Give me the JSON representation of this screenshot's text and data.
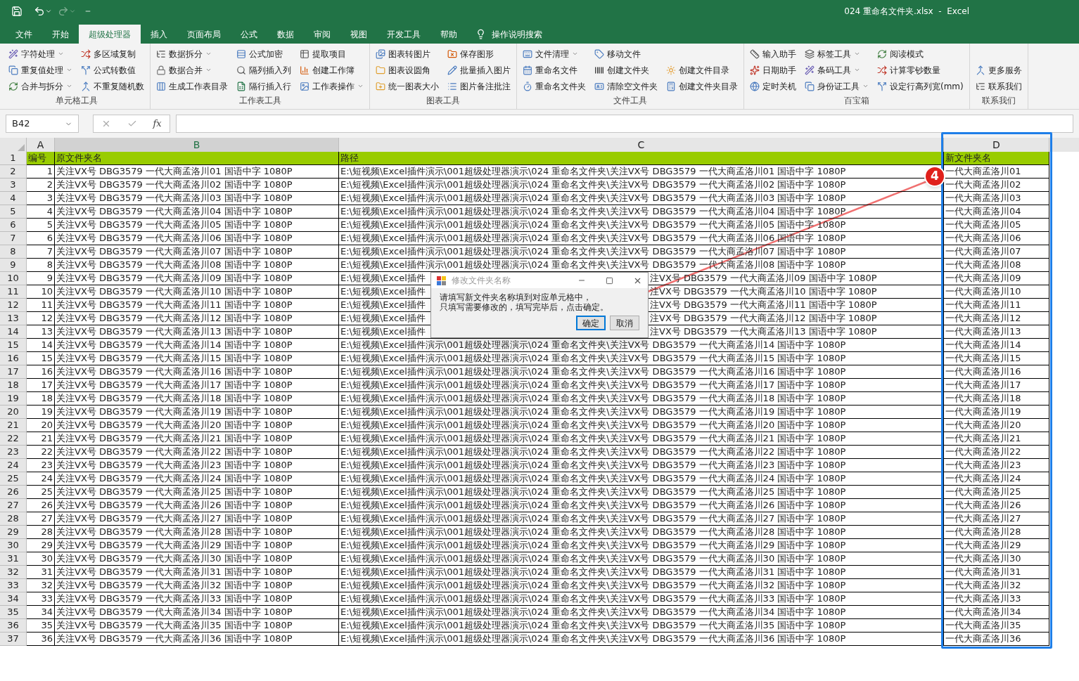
{
  "window": {
    "title": "024 重命名文件夹.xlsx  -  Excel"
  },
  "menu_tabs": [
    {
      "label": "文件",
      "selected": false
    },
    {
      "label": "开始",
      "selected": false
    },
    {
      "label": "超级处理器",
      "selected": true
    },
    {
      "label": "插入",
      "selected": false
    },
    {
      "label": "页面布局",
      "selected": false
    },
    {
      "label": "公式",
      "selected": false
    },
    {
      "label": "数据",
      "selected": false
    },
    {
      "label": "审阅",
      "selected": false
    },
    {
      "label": "视图",
      "selected": false
    },
    {
      "label": "开发工具",
      "selected": false
    },
    {
      "label": "帮助",
      "selected": false
    }
  ],
  "search_tab": "操作说明搜索",
  "ribbon_groups": [
    {
      "title": "单元格工具",
      "columns": [
        [
          {
            "label": "字符处理",
            "dropdown": true
          },
          {
            "label": "重复值处理",
            "dropdown": true
          },
          {
            "label": "合并与拆分",
            "dropdown": true
          }
        ],
        [
          {
            "label": "多区域复制",
            "dropdown": false
          },
          {
            "label": "公式转数值",
            "dropdown": false
          },
          {
            "label": "不重复随机数",
            "dropdown": false
          }
        ]
      ]
    },
    {
      "title": "工作表工具",
      "columns": [
        [
          {
            "label": "数据拆分",
            "dropdown": true
          },
          {
            "label": "数据合并",
            "dropdown": true
          },
          {
            "label": "生成工作表目录",
            "dropdown": false
          }
        ],
        [
          {
            "label": "公式加密",
            "dropdown": false
          },
          {
            "label": "隔列插入列",
            "dropdown": false
          },
          {
            "label": "隔行插入行",
            "dropdown": false
          }
        ],
        [
          {
            "label": "提取项目",
            "dropdown": false
          },
          {
            "label": "创建工作簿",
            "dropdown": false
          },
          {
            "label": "工作表操作",
            "dropdown": true
          }
        ]
      ]
    },
    {
      "title": "图表工具",
      "columns": [
        [
          {
            "label": "图表转图片",
            "dropdown": false
          },
          {
            "label": "图表设圆角",
            "dropdown": false
          },
          {
            "label": "统一图表大小",
            "dropdown": false
          }
        ],
        [
          {
            "label": "保存图形",
            "dropdown": false
          },
          {
            "label": "批量插入图片",
            "dropdown": false
          },
          {
            "label": "图片备注批注",
            "dropdown": false
          }
        ]
      ]
    },
    {
      "title": "文件工具",
      "columns": [
        [
          {
            "label": "文件清理",
            "dropdown": true
          },
          {
            "label": "重命名文件",
            "dropdown": false
          },
          {
            "label": "重命名文件夹",
            "dropdown": false
          }
        ],
        [
          {
            "label": "移动文件",
            "dropdown": false
          },
          {
            "label": "创建文件夹",
            "dropdown": false
          },
          {
            "label": "清除空文件夹",
            "dropdown": false
          }
        ],
        [
          {
            "label": "创建文件目录",
            "dropdown": false
          },
          {
            "label": "创建文件夹目录",
            "dropdown": false
          }
        ]
      ]
    },
    {
      "title": "百宝箱",
      "columns": [
        [
          {
            "label": "输入助手",
            "dropdown": false
          },
          {
            "label": "日期助手",
            "dropdown": false
          },
          {
            "label": "定时关机",
            "dropdown": false
          }
        ],
        [
          {
            "label": "标签工具",
            "dropdown": true
          },
          {
            "label": "条码工具",
            "dropdown": true
          },
          {
            "label": "身份证工具",
            "dropdown": true
          }
        ],
        [
          {
            "label": "阅读模式",
            "dropdown": false
          },
          {
            "label": "计算零钞数量",
            "dropdown": false
          },
          {
            "label": "设定行高列宽(mm)",
            "dropdown": false
          }
        ]
      ]
    },
    {
      "title": "联系我们",
      "columns": [
        [
          {
            "label": "更多服务",
            "dropdown": false
          },
          {
            "label": "联系我们",
            "dropdown": false
          }
        ]
      ]
    }
  ],
  "name_box": "B42",
  "formula_fx": "fx",
  "column_headers": [
    {
      "label": "A",
      "selected": false
    },
    {
      "label": "B",
      "selected": true
    },
    {
      "label": "C",
      "selected": false
    },
    {
      "label": "D",
      "selected": false
    }
  ],
  "header_row": {
    "number": "1",
    "cells": [
      "编号",
      "原文件夹名",
      "路径",
      "新文件夹名"
    ]
  },
  "rows": [
    {
      "kind": "data",
      "number": "2",
      "id": "1",
      "original": "关注VX号 DBG3579 一代大商孟洛川01 国语中字 1080P",
      "path": "E:\\短视频\\Excel插件演示\\001超级处理器演示\\024 重命名文件夹\\关注VX号 DBG3579 一代大商孟洛川01 国语中字 1080P",
      "new_name": "一代大商孟洛川01"
    },
    {
      "kind": "data",
      "number": "3",
      "id": "2",
      "original": "关注VX号 DBG3579 一代大商孟洛川02 国语中字 1080P",
      "path": "E:\\短视频\\Excel插件演示\\001超级处理器演示\\024 重命名文件夹\\关注VX号 DBG3579 一代大商孟洛川02 国语中字 1080P",
      "new_name": "一代大商孟洛川02"
    },
    {
      "kind": "data",
      "number": "4",
      "id": "3",
      "original": "关注VX号 DBG3579 一代大商孟洛川03 国语中字 1080P",
      "path": "E:\\短视频\\Excel插件演示\\001超级处理器演示\\024 重命名文件夹\\关注VX号 DBG3579 一代大商孟洛川03 国语中字 1080P",
      "new_name": "一代大商孟洛川03"
    },
    {
      "kind": "data",
      "number": "5",
      "id": "4",
      "original": "关注VX号 DBG3579 一代大商孟洛川04 国语中字 1080P",
      "path": "E:\\短视频\\Excel插件演示\\001超级处理器演示\\024 重命名文件夹\\关注VX号 DBG3579 一代大商孟洛川04 国语中字 1080P",
      "new_name": "一代大商孟洛川04"
    },
    {
      "kind": "data",
      "number": "6",
      "id": "5",
      "original": "关注VX号 DBG3579 一代大商孟洛川05 国语中字 1080P",
      "path": "E:\\短视频\\Excel插件演示\\001超级处理器演示\\024 重命名文件夹\\关注VX号 DBG3579 一代大商孟洛川05 国语中字 1080P",
      "new_name": "一代大商孟洛川05"
    },
    {
      "kind": "data",
      "number": "7",
      "id": "6",
      "original": "关注VX号 DBG3579 一代大商孟洛川06 国语中字 1080P",
      "path": "E:\\短视频\\Excel插件演示\\001超级处理器演示\\024 重命名文件夹\\关注VX号 DBG3579 一代大商孟洛川06 国语中字 1080P",
      "new_name": "一代大商孟洛川06"
    },
    {
      "kind": "data",
      "number": "8",
      "id": "7",
      "original": "关注VX号 DBG3579 一代大商孟洛川07 国语中字 1080P",
      "path": "E:\\短视频\\Excel插件演示\\001超级处理器演示\\024 重命名文件夹\\关注VX号 DBG3579 一代大商孟洛川07 国语中字 1080P",
      "new_name": "一代大商孟洛川07"
    },
    {
      "kind": "data",
      "number": "9",
      "id": "8",
      "original": "关注VX号 DBG3579 一代大商孟洛川08 国语中字 1080P",
      "path": "E:\\短视频\\Excel插件演示\\001超级处理器演示\\024 重命名文件夹\\关注VX号 DBG3579 一代大商孟洛川08 国语中字 1080P",
      "new_name": "一代大商孟洛川08"
    },
    {
      "kind": "covered",
      "number": "10",
      "id": "9",
      "original": "关注VX号 DBG3579 一代大商孟洛川09 国语中字 1080P",
      "path_start": "E:\\短视频\\Excel插件",
      "path_end": "注VX号 DBG3579 一代大商孟洛川09 国语中字 1080P",
      "new_name": "一代大商孟洛川09"
    },
    {
      "kind": "covered",
      "number": "11",
      "id": "10",
      "original": "关注VX号 DBG3579 一代大商孟洛川10 国语中字 1080P",
      "path_start": "E:\\短视频\\Excel插件",
      "path_end": "注VX号 DBG3579 一代大商孟洛川10 国语中字 1080P",
      "new_name": "一代大商孟洛川10"
    },
    {
      "kind": "covered",
      "number": "12",
      "id": "11",
      "original": "关注VX号 DBG3579 一代大商孟洛川11 国语中字 1080P",
      "path_start": "E:\\短视频\\Excel插件",
      "path_end": "注VX号 DBG3579 一代大商孟洛川11 国语中字 1080P",
      "new_name": "一代大商孟洛川11"
    },
    {
      "kind": "covered",
      "number": "13",
      "id": "12",
      "original": "关注VX号 DBG3579 一代大商孟洛川12 国语中字 1080P",
      "path_start": "E:\\短视频\\Excel插件",
      "path_end": "注VX号 DBG3579 一代大商孟洛川12 国语中字 1080P",
      "new_name": "一代大商孟洛川12"
    },
    {
      "kind": "covered",
      "number": "14",
      "id": "13",
      "original": "关注VX号 DBG3579 一代大商孟洛川13 国语中字 1080P",
      "path_start": "E:\\短视频\\Excel插件",
      "path_end": "注VX号 DBG3579 一代大商孟洛川13 国语中字 1080P",
      "new_name": "一代大商孟洛川13"
    },
    {
      "kind": "data",
      "number": "15",
      "id": "14",
      "original": "关注VX号 DBG3579 一代大商孟洛川14 国语中字 1080P",
      "path": "E:\\短视频\\Excel插件演示\\001超级处理器演示\\024 重命名文件夹\\关注VX号 DBG3579 一代大商孟洛川14 国语中字 1080P",
      "new_name": "一代大商孟洛川14"
    },
    {
      "kind": "data",
      "number": "16",
      "id": "15",
      "original": "关注VX号 DBG3579 一代大商孟洛川15 国语中字 1080P",
      "path": "E:\\短视频\\Excel插件演示\\001超级处理器演示\\024 重命名文件夹\\关注VX号 DBG3579 一代大商孟洛川15 国语中字 1080P",
      "new_name": "一代大商孟洛川15"
    },
    {
      "kind": "data",
      "number": "17",
      "id": "16",
      "original": "关注VX号 DBG3579 一代大商孟洛川16 国语中字 1080P",
      "path": "E:\\短视频\\Excel插件演示\\001超级处理器演示\\024 重命名文件夹\\关注VX号 DBG3579 一代大商孟洛川16 国语中字 1080P",
      "new_name": "一代大商孟洛川16"
    },
    {
      "kind": "data",
      "number": "18",
      "id": "17",
      "original": "关注VX号 DBG3579 一代大商孟洛川17 国语中字 1080P",
      "path": "E:\\短视频\\Excel插件演示\\001超级处理器演示\\024 重命名文件夹\\关注VX号 DBG3579 一代大商孟洛川17 国语中字 1080P",
      "new_name": "一代大商孟洛川17"
    },
    {
      "kind": "data",
      "number": "19",
      "id": "18",
      "original": "关注VX号 DBG3579 一代大商孟洛川18 国语中字 1080P",
      "path": "E:\\短视频\\Excel插件演示\\001超级处理器演示\\024 重命名文件夹\\关注VX号 DBG3579 一代大商孟洛川18 国语中字 1080P",
      "new_name": "一代大商孟洛川18"
    },
    {
      "kind": "data",
      "number": "20",
      "id": "19",
      "original": "关注VX号 DBG3579 一代大商孟洛川19 国语中字 1080P",
      "path": "E:\\短视频\\Excel插件演示\\001超级处理器演示\\024 重命名文件夹\\关注VX号 DBG3579 一代大商孟洛川19 国语中字 1080P",
      "new_name": "一代大商孟洛川19"
    },
    {
      "kind": "data",
      "number": "21",
      "id": "20",
      "original": "关注VX号 DBG3579 一代大商孟洛川20 国语中字 1080P",
      "path": "E:\\短视频\\Excel插件演示\\001超级处理器演示\\024 重命名文件夹\\关注VX号 DBG3579 一代大商孟洛川20 国语中字 1080P",
      "new_name": "一代大商孟洛川20"
    },
    {
      "kind": "data",
      "number": "22",
      "id": "21",
      "original": "关注VX号 DBG3579 一代大商孟洛川21 国语中字 1080P",
      "path": "E:\\短视频\\Excel插件演示\\001超级处理器演示\\024 重命名文件夹\\关注VX号 DBG3579 一代大商孟洛川21 国语中字 1080P",
      "new_name": "一代大商孟洛川21"
    },
    {
      "kind": "data",
      "number": "23",
      "id": "22",
      "original": "关注VX号 DBG3579 一代大商孟洛川22 国语中字 1080P",
      "path": "E:\\短视频\\Excel插件演示\\001超级处理器演示\\024 重命名文件夹\\关注VX号 DBG3579 一代大商孟洛川22 国语中字 1080P",
      "new_name": "一代大商孟洛川22"
    },
    {
      "kind": "data",
      "number": "24",
      "id": "23",
      "original": "关注VX号 DBG3579 一代大商孟洛川23 国语中字 1080P",
      "path": "E:\\短视频\\Excel插件演示\\001超级处理器演示\\024 重命名文件夹\\关注VX号 DBG3579 一代大商孟洛川23 国语中字 1080P",
      "new_name": "一代大商孟洛川23"
    },
    {
      "kind": "data",
      "number": "25",
      "id": "24",
      "original": "关注VX号 DBG3579 一代大商孟洛川24 国语中字 1080P",
      "path": "E:\\短视频\\Excel插件演示\\001超级处理器演示\\024 重命名文件夹\\关注VX号 DBG3579 一代大商孟洛川24 国语中字 1080P",
      "new_name": "一代大商孟洛川24"
    },
    {
      "kind": "data",
      "number": "26",
      "id": "25",
      "original": "关注VX号 DBG3579 一代大商孟洛川25 国语中字 1080P",
      "path": "E:\\短视频\\Excel插件演示\\001超级处理器演示\\024 重命名文件夹\\关注VX号 DBG3579 一代大商孟洛川25 国语中字 1080P",
      "new_name": "一代大商孟洛川25"
    },
    {
      "kind": "data",
      "number": "27",
      "id": "26",
      "original": "关注VX号 DBG3579 一代大商孟洛川26 国语中字 1080P",
      "path": "E:\\短视频\\Excel插件演示\\001超级处理器演示\\024 重命名文件夹\\关注VX号 DBG3579 一代大商孟洛川26 国语中字 1080P",
      "new_name": "一代大商孟洛川26"
    },
    {
      "kind": "data",
      "number": "28",
      "id": "27",
      "original": "关注VX号 DBG3579 一代大商孟洛川27 国语中字 1080P",
      "path": "E:\\短视频\\Excel插件演示\\001超级处理器演示\\024 重命名文件夹\\关注VX号 DBG3579 一代大商孟洛川27 国语中字 1080P",
      "new_name": "一代大商孟洛川27"
    },
    {
      "kind": "data",
      "number": "29",
      "id": "28",
      "original": "关注VX号 DBG3579 一代大商孟洛川28 国语中字 1080P",
      "path": "E:\\短视频\\Excel插件演示\\001超级处理器演示\\024 重命名文件夹\\关注VX号 DBG3579 一代大商孟洛川28 国语中字 1080P",
      "new_name": "一代大商孟洛川28"
    },
    {
      "kind": "data",
      "number": "30",
      "id": "29",
      "original": "关注VX号 DBG3579 一代大商孟洛川29 国语中字 1080P",
      "path": "E:\\短视频\\Excel插件演示\\001超级处理器演示\\024 重命名文件夹\\关注VX号 DBG3579 一代大商孟洛川29 国语中字 1080P",
      "new_name": "一代大商孟洛川29"
    },
    {
      "kind": "data",
      "number": "31",
      "id": "30",
      "original": "关注VX号 DBG3579 一代大商孟洛川30 国语中字 1080P",
      "path": "E:\\短视频\\Excel插件演示\\001超级处理器演示\\024 重命名文件夹\\关注VX号 DBG3579 一代大商孟洛川30 国语中字 1080P",
      "new_name": "一代大商孟洛川30"
    },
    {
      "kind": "data",
      "number": "32",
      "id": "31",
      "original": "关注VX号 DBG3579 一代大商孟洛川31 国语中字 1080P",
      "path": "E:\\短视频\\Excel插件演示\\001超级处理器演示\\024 重命名文件夹\\关注VX号 DBG3579 一代大商孟洛川31 国语中字 1080P",
      "new_name": "一代大商孟洛川31"
    },
    {
      "kind": "data",
      "number": "33",
      "id": "32",
      "original": "关注VX号 DBG3579 一代大商孟洛川32 国语中字 1080P",
      "path": "E:\\短视频\\Excel插件演示\\001超级处理器演示\\024 重命名文件夹\\关注VX号 DBG3579 一代大商孟洛川32 国语中字 1080P",
      "new_name": "一代大商孟洛川32"
    },
    {
      "kind": "data",
      "number": "34",
      "id": "33",
      "original": "关注VX号 DBG3579 一代大商孟洛川33 国语中字 1080P",
      "path": "E:\\短视频\\Excel插件演示\\001超级处理器演示\\024 重命名文件夹\\关注VX号 DBG3579 一代大商孟洛川33 国语中字 1080P",
      "new_name": "一代大商孟洛川33"
    },
    {
      "kind": "data",
      "number": "35",
      "id": "34",
      "original": "关注VX号 DBG3579 一代大商孟洛川34 国语中字 1080P",
      "path": "E:\\短视频\\Excel插件演示\\001超级处理器演示\\024 重命名文件夹\\关注VX号 DBG3579 一代大商孟洛川34 国语中字 1080P",
      "new_name": "一代大商孟洛川34"
    },
    {
      "kind": "data",
      "number": "36",
      "id": "35",
      "original": "关注VX号 DBG3579 一代大商孟洛川35 国语中字 1080P",
      "path": "E:\\短视频\\Excel插件演示\\001超级处理器演示\\024 重命名文件夹\\关注VX号 DBG3579 一代大商孟洛川35 国语中字 1080P",
      "new_name": "一代大商孟洛川35"
    },
    {
      "kind": "data",
      "number": "37",
      "id": "36",
      "original": "关注VX号 DBG3579 一代大商孟洛川36 国语中字 1080P",
      "path": "E:\\短视频\\Excel插件演示\\001超级处理器演示\\024 重命名文件夹\\关注VX号 DBG3579 一代大商孟洛川36 国语中字 1080P",
      "new_name": "一代大商孟洛川36"
    }
  ],
  "dialog": {
    "title": "修改文件夹名称",
    "message_lines": [
      "请填写新文件夹名称填到对应单元格中，",
      "只填写需要修改的，填写完毕后，点击确定。"
    ],
    "buttons": [
      {
        "label": "确定",
        "default": true
      },
      {
        "label": "取消",
        "default": false
      }
    ]
  },
  "annotation": {
    "badge": "4"
  }
}
